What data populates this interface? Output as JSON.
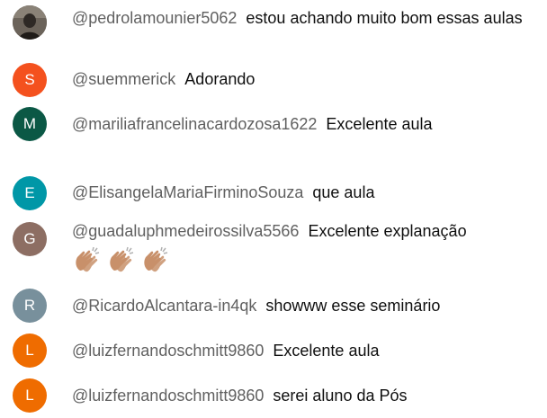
{
  "messages": [
    {
      "author": "@pedrolamounier5062",
      "text": "estou achando muito bom essas aulas",
      "avatar_letter": "",
      "avatar_color": "#5a5148",
      "avatar_type": "photo"
    },
    {
      "author": "@suemmerick",
      "text": "Adorando",
      "avatar_letter": "S",
      "avatar_color": "#f4511e"
    },
    {
      "author": "@mariliafrancelinacardozosa1622",
      "text": "Excelente aula",
      "avatar_letter": "M",
      "avatar_color": "#0b5845"
    },
    {
      "author": "@ElisangelaMariaFirminoSouza",
      "text": "que aula",
      "avatar_letter": "E",
      "avatar_color": "#0097a7"
    },
    {
      "author": "@guadaluphmedeirossilva5566",
      "text": "Excelente explanação",
      "avatar_letter": "G",
      "avatar_color": "#8d6e63",
      "emojis": [
        "clapping-hands",
        "clapping-hands",
        "clapping-hands"
      ],
      "emoji_color": "#c8906a"
    },
    {
      "author": "@RicardoAlcantara-in4qk",
      "text": "showww esse seminário",
      "avatar_letter": "R",
      "avatar_color": "#78909c"
    },
    {
      "author": "@luizfernandoschmitt9860",
      "text": "Excelente aula",
      "avatar_letter": "L",
      "avatar_color": "#ef6c00"
    },
    {
      "author": "@luizfernandoschmitt9860",
      "text": "serei aluno da Pós",
      "avatar_letter": "L",
      "avatar_color": "#ef6c00"
    }
  ]
}
